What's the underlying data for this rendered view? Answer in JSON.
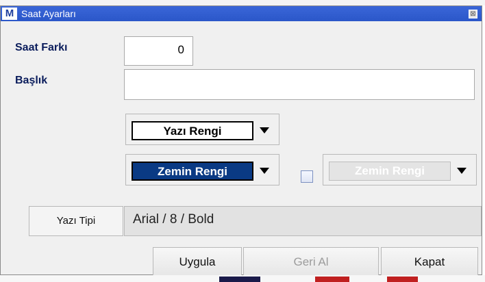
{
  "window": {
    "title": "Saat Ayarları",
    "logo": "M"
  },
  "form": {
    "time_offset_label": "Saat Farkı",
    "time_offset_value": "0",
    "heading_label": "Başlık",
    "heading_value": ""
  },
  "pickers": {
    "text_color": {
      "label": "Yazı Rengi",
      "swatch": "#ffffff",
      "text": "#000000"
    },
    "background_color": {
      "label": "Zemin Rengi",
      "swatch": "#0a3a84",
      "text": "#ffffff"
    },
    "alt_background_color": {
      "label": "Zemin Rengi",
      "enabled": false,
      "checked": false
    }
  },
  "font": {
    "button_label": "Yazı Tipi",
    "value": "Arial / 8 / Bold"
  },
  "buttons": {
    "apply": "Uygula",
    "revert": "Geri Al",
    "close": "Kapat"
  },
  "icons": {
    "close": "close-icon",
    "dropdown": "triangle-down-icon"
  },
  "colors": {
    "titlebar": "#2b57c9",
    "label_text": "#0b1d5c"
  }
}
